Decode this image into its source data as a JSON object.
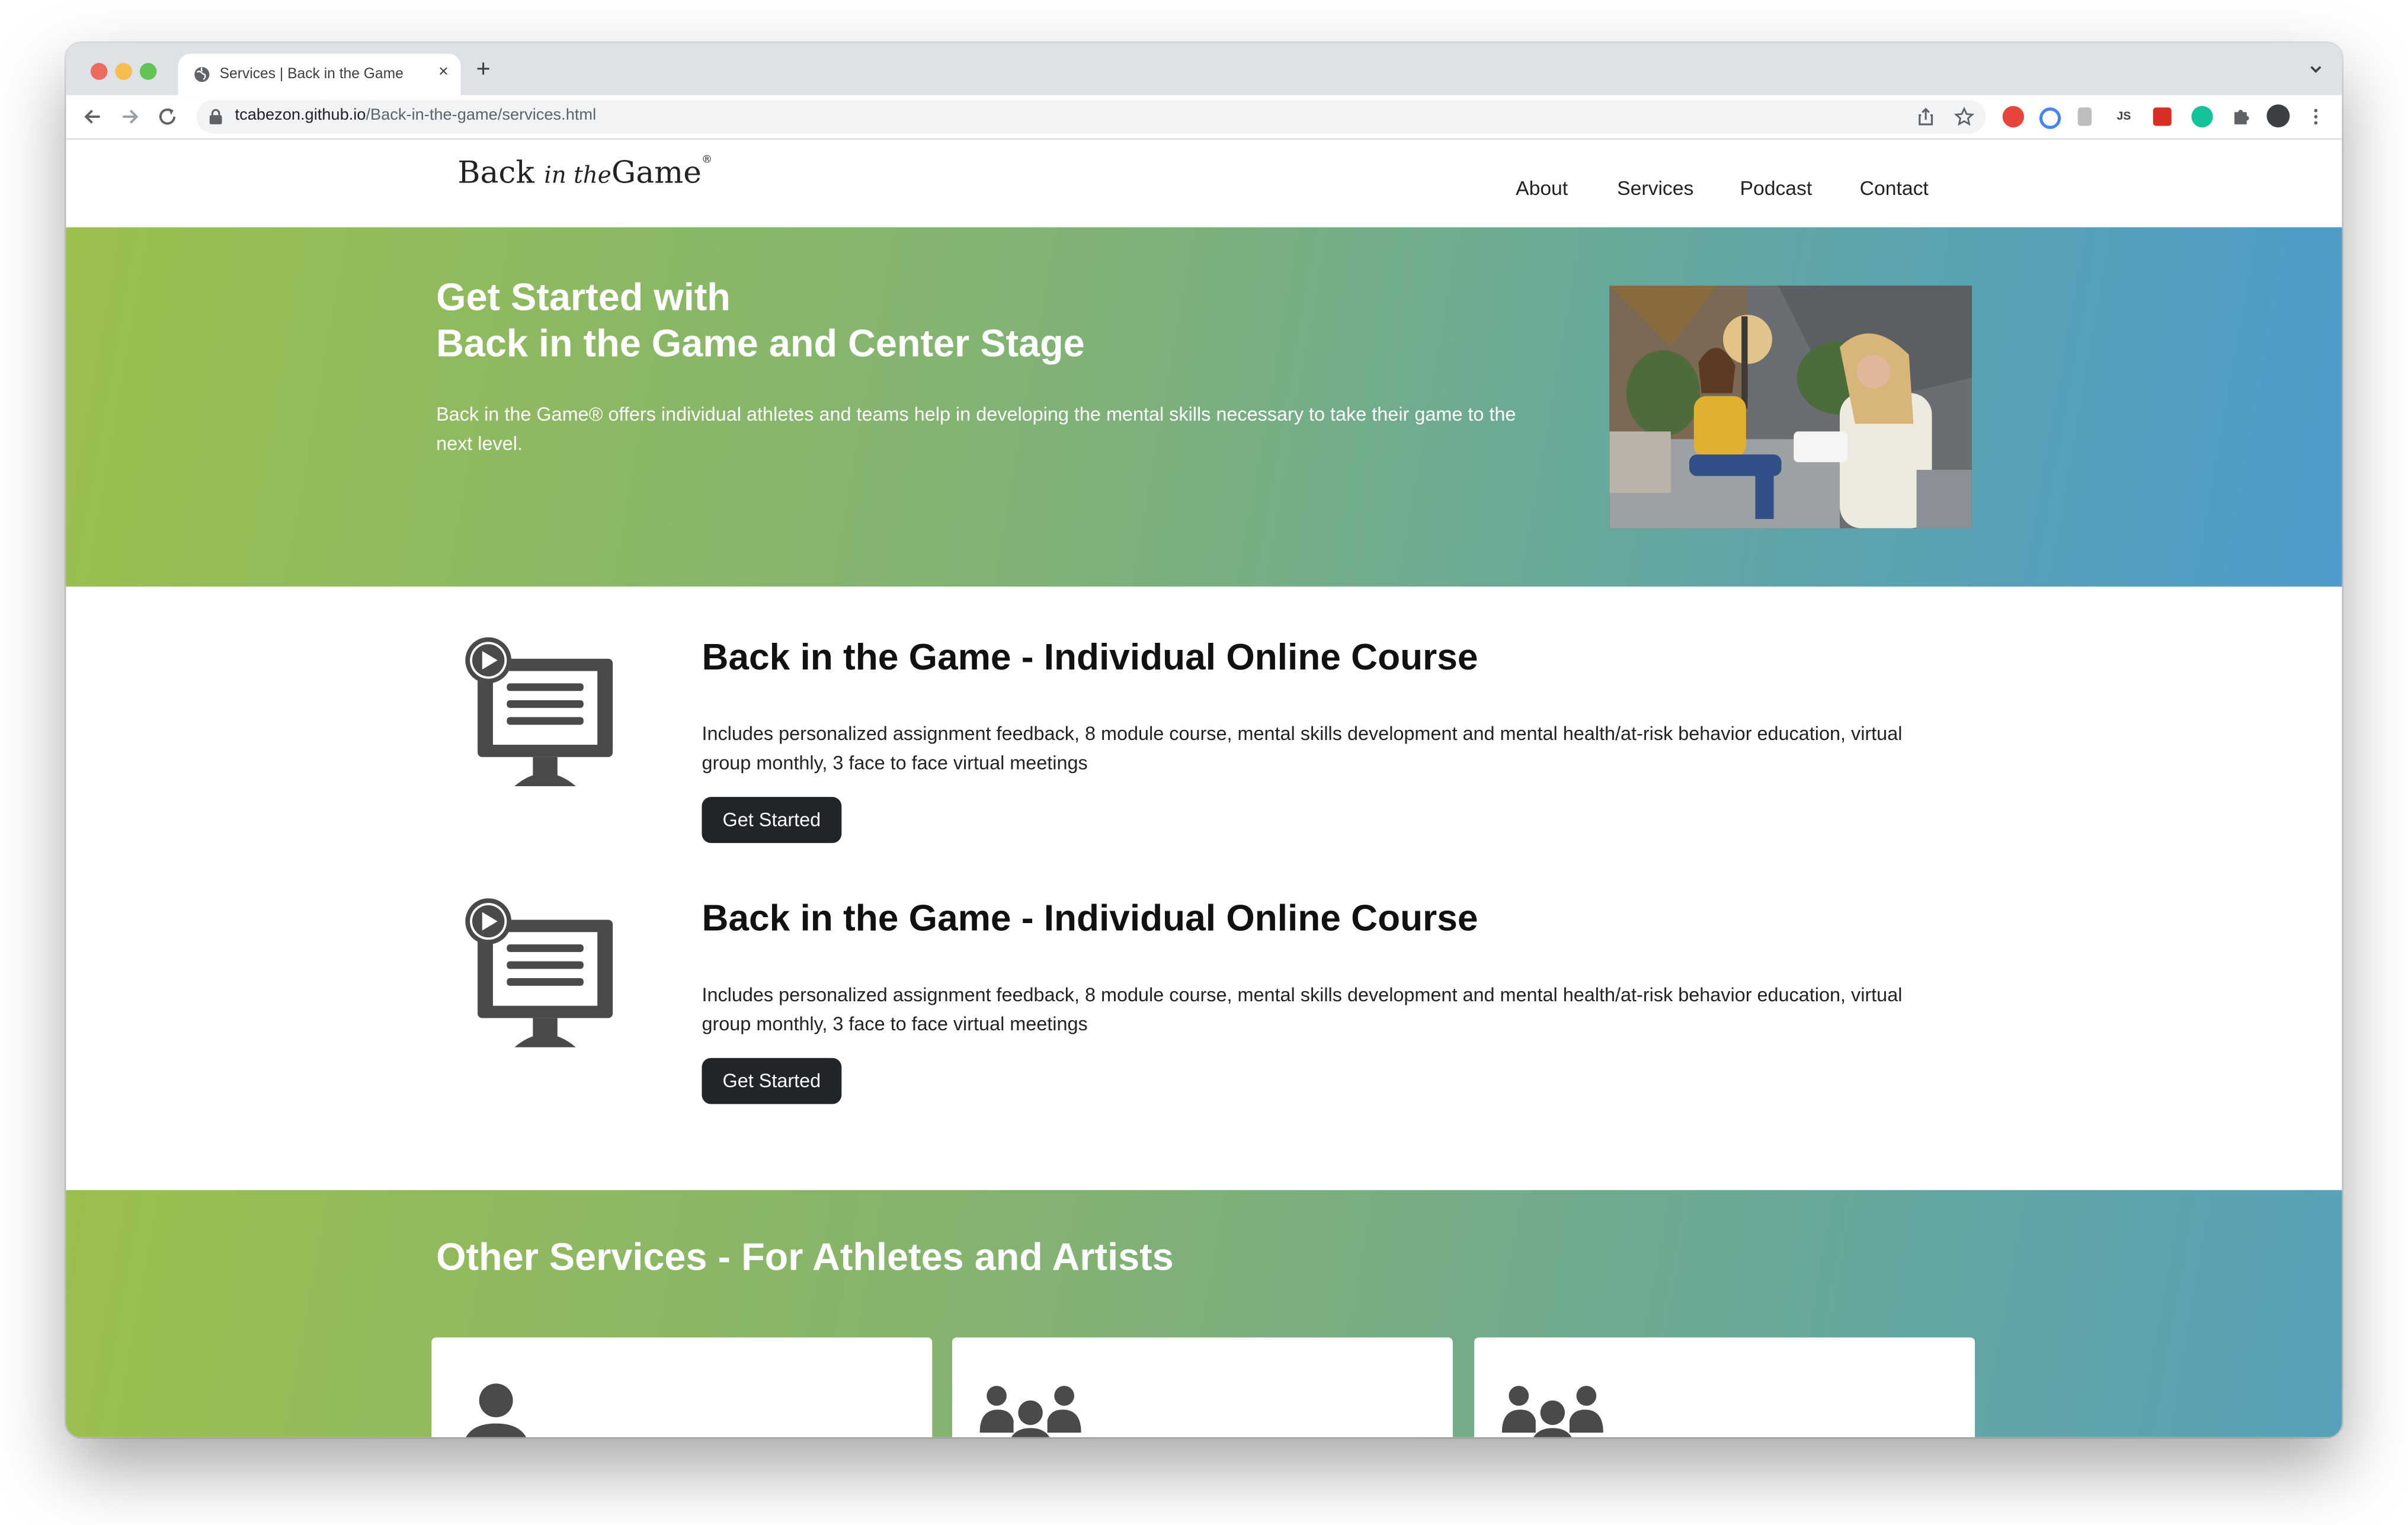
{
  "browser": {
    "tab_title": "Services | Back in the Game",
    "new_tab_symbol": "+",
    "close_symbol": "×",
    "url_host": "tcabezon.github.io",
    "url_path": "/Back-in-the-game/services.html",
    "extension_js_label": "JS"
  },
  "site": {
    "logo": {
      "word1": "Back",
      "script": "in the",
      "word2": "Game",
      "mark": "®"
    },
    "nav": [
      {
        "label": "About"
      },
      {
        "label": "Services"
      },
      {
        "label": "Podcast"
      },
      {
        "label": "Contact"
      }
    ]
  },
  "hero": {
    "title_line1": "Get Started with",
    "title_line2": "Back in the Game and Center Stage",
    "text": "Back in the Game® offers individual athletes and teams help in developing the mental skills necessary to take their game to the next level."
  },
  "courses": [
    {
      "title": "Back in the Game - Individual Online Course",
      "description": "Includes personalized assignment feedback, 8 module course, mental skills development and mental health/at-risk behavior education, virtual group monthly, 3 face to face virtual meetings",
      "button": "Get Started",
      "icon": "online-course-icon"
    },
    {
      "title": "Back in the Game - Individual Online Course",
      "description": "Includes personalized assignment feedback, 8 module course, mental skills development and mental health/at-risk behavior education, virtual group monthly, 3 face to face virtual meetings",
      "button": "Get Started",
      "icon": "online-course-icon"
    }
  ],
  "other_services": {
    "title": "Other Services - For Athletes and Artists",
    "cards": [
      {
        "icon": "person-icon"
      },
      {
        "icon": "group-icon"
      },
      {
        "icon": "group-icon"
      }
    ]
  },
  "colors": {
    "gradient_start": "#9bbf4e",
    "gradient_end": "#4c9bcc",
    "button_bg": "#212429",
    "icon_gray": "#4a4a4a"
  }
}
